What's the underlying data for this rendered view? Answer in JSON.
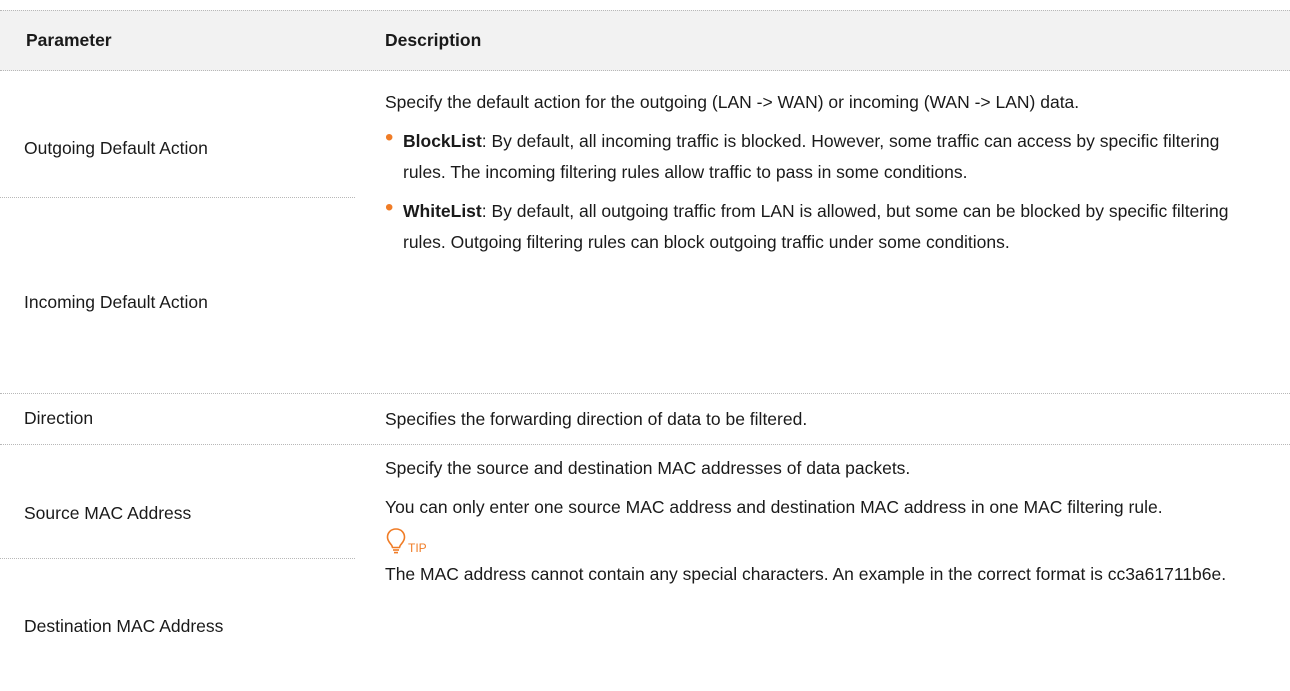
{
  "header": {
    "parameter": "Parameter",
    "description": "Description"
  },
  "group1": {
    "param_a": "Outgoing Default Action",
    "param_b": "Incoming Default Action",
    "intro": "Specify the default action for the outgoing (LAN -> WAN) or incoming (WAN -> LAN) data.",
    "bullets": [
      {
        "term": "BlockList",
        "text": ": By default, all incoming traffic is blocked. However, some traffic can access by specific filtering rules. The incoming filtering rules allow traffic to pass in some conditions."
      },
      {
        "term": "WhiteList",
        "text": ": By default, all outgoing traffic from LAN is allowed, but some can be blocked by specific filtering rules. Outgoing filtering rules can block outgoing traffic under some conditions."
      }
    ]
  },
  "group2": {
    "param": "Direction",
    "description": "Specifies the forwarding direction of data to be filtered."
  },
  "group3": {
    "param_a": "Source MAC Address",
    "param_b": "Destination MAC Address",
    "para1": "Specify the source and destination MAC addresses of data packets.",
    "para2": "You can only enter one source MAC address and destination MAC address in one MAC filtering rule.",
    "tip_label": "TIP",
    "tip_text": "The MAC address cannot contain any special characters. An example in the correct format is cc3a61711b6e."
  },
  "colors": {
    "accent": "#f07c26",
    "header_bg": "#f2f2f2",
    "text": "#1a1a1a"
  },
  "icons": {
    "bullet": "bullet-dot",
    "tip": "lightbulb-icon"
  }
}
